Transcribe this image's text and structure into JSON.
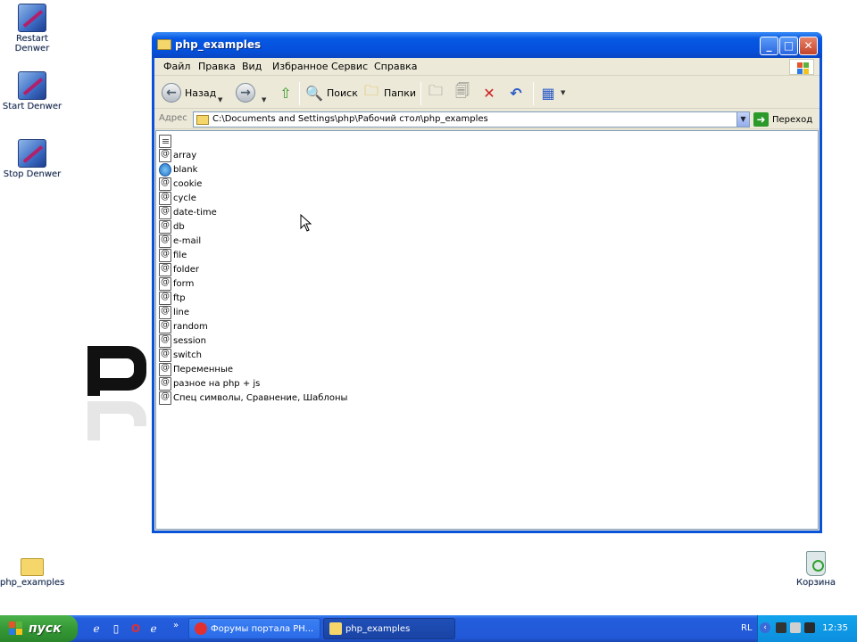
{
  "desktop": {
    "icons": [
      {
        "label": "Restart Denwer",
        "icon": "service-icon"
      },
      {
        "label": "Start Denwer",
        "icon": "service-icon"
      },
      {
        "label": "Stop Denwer",
        "icon": "service-icon"
      },
      {
        "label": "php_examples",
        "icon": "folder-icon"
      },
      {
        "label": "Корзина",
        "icon": "recycle-bin-icon"
      }
    ]
  },
  "window": {
    "title": "php_examples",
    "menu": [
      "Файл",
      "Правка",
      "Вид",
      "Избранное",
      "Сервис",
      "Справка"
    ],
    "toolbar": {
      "back": "Назад",
      "search": "Поиск",
      "folders": "Папки"
    },
    "address": {
      "label": "Адрес",
      "value": "C:\\Documents and Settings\\php\\Рабочий стол\\php_examples",
      "go": "Переход"
    },
    "files": [
      {
        "name": "",
        "icon": "document-icon"
      },
      {
        "name": "array",
        "icon": "php-file-icon"
      },
      {
        "name": "blank",
        "icon": "ie-file-icon"
      },
      {
        "name": "cookie",
        "icon": "php-file-icon"
      },
      {
        "name": "cycle",
        "icon": "php-file-icon"
      },
      {
        "name": "date-time",
        "icon": "php-file-icon"
      },
      {
        "name": "db",
        "icon": "php-file-icon"
      },
      {
        "name": "e-mail",
        "icon": "php-file-icon"
      },
      {
        "name": "file",
        "icon": "php-file-icon"
      },
      {
        "name": "folder",
        "icon": "php-file-icon"
      },
      {
        "name": "form",
        "icon": "php-file-icon"
      },
      {
        "name": "ftp",
        "icon": "php-file-icon"
      },
      {
        "name": "line",
        "icon": "php-file-icon"
      },
      {
        "name": "random",
        "icon": "php-file-icon"
      },
      {
        "name": "session",
        "icon": "php-file-icon"
      },
      {
        "name": "switch",
        "icon": "php-file-icon"
      },
      {
        "name": "Переменные",
        "icon": "php-file-icon"
      },
      {
        "name": "разное на php + js",
        "icon": "php-file-icon"
      },
      {
        "name": "Спец символы, Сравнение, Шаблоны",
        "icon": "php-file-icon"
      }
    ]
  },
  "taskbar": {
    "start_label": "пуск",
    "tasks": [
      {
        "label": "Форумы портала PH...",
        "icon": "opera-icon",
        "active": false
      },
      {
        "label": "php_examples",
        "icon": "folder-icon",
        "active": true
      }
    ],
    "language": "RL",
    "clock": "12:35"
  },
  "colors": {
    "titlebar": "#0759e4",
    "window_bg": "#ece9d8",
    "taskbar": "#245edc",
    "start_button": "#359935",
    "tray": "#0c8fde"
  }
}
